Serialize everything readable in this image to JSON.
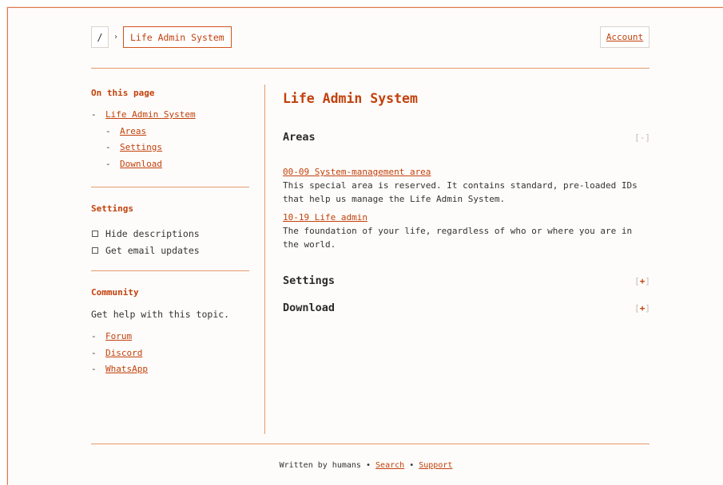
{
  "header": {
    "root_crumb": "/",
    "separator": "›",
    "current_crumb": "Life Admin System",
    "account_label": "Account"
  },
  "sidebar": {
    "on_this_page": {
      "title": "On this page",
      "items": [
        {
          "dash": "-",
          "label": "Life Admin System"
        },
        {
          "dash": "-",
          "label": "Areas"
        },
        {
          "dash": "-",
          "label": "Settings"
        },
        {
          "dash": "-",
          "label": "Download"
        }
      ]
    },
    "settings": {
      "title": "Settings",
      "options": [
        {
          "label": "Hide descriptions",
          "checked": false
        },
        {
          "label": "Get email updates",
          "checked": false
        }
      ]
    },
    "community": {
      "title": "Community",
      "text": "Get help with this topic.",
      "links": [
        {
          "dash": "-",
          "label": "Forum"
        },
        {
          "dash": "-",
          "label": "Discord"
        },
        {
          "dash": "-",
          "label": "WhatsApp"
        }
      ]
    }
  },
  "main": {
    "title": "Life Admin System",
    "sections": [
      {
        "heading": "Areas",
        "toggle_open": "[",
        "toggle_sym": "-",
        "toggle_close": "]"
      },
      {
        "heading": "Settings",
        "toggle_open": "[",
        "toggle_sym": "+",
        "toggle_close": "]"
      },
      {
        "heading": "Download",
        "toggle_open": "[",
        "toggle_sym": "+",
        "toggle_close": "]"
      }
    ],
    "areas": [
      {
        "link": "00-09 System-management area",
        "desc": "This special area is reserved. It contains standard, pre-loaded IDs that help us manage the Life Admin System."
      },
      {
        "link": "10-19 Life admin",
        "desc": "The foundation of your life, regardless of who or where you are in the world."
      }
    ]
  },
  "footer": {
    "prefix": "Written by humans",
    "dot": "•",
    "search": "Search",
    "support": "Support"
  },
  "colors": {
    "accent": "#c2410c",
    "rule": "#e8996e",
    "background": "#fdfcfa"
  }
}
